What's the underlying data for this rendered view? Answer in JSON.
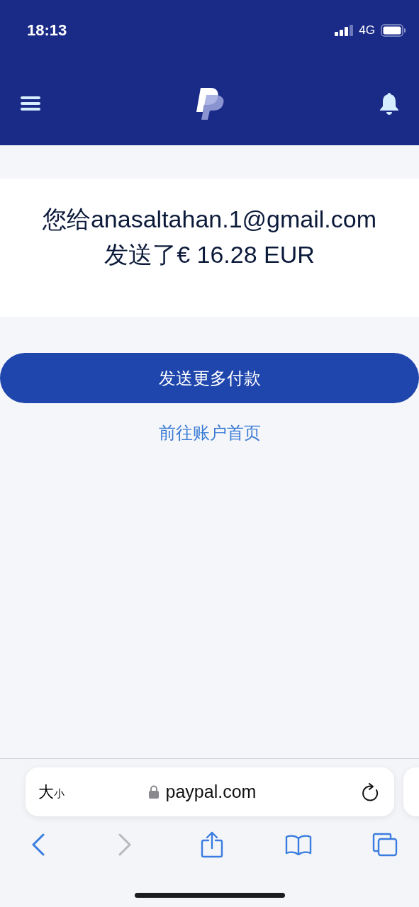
{
  "status_bar": {
    "time": "18:13",
    "network": "4G"
  },
  "message_lines": [
    "您给anasaltahan.1@gmail.com",
    "发送了€ 16.28 EUR"
  ],
  "actions": {
    "primary": "发送更多付款",
    "link": "前往账户首页"
  },
  "browser": {
    "text_size": {
      "big": "大",
      "small": "小"
    },
    "address": "paypal.com",
    "nav": [
      {
        "kind": "back",
        "disabled": false
      },
      {
        "kind": "forward",
        "disabled": true
      },
      {
        "kind": "share",
        "disabled": false
      },
      {
        "kind": "bookmarks",
        "disabled": false
      },
      {
        "kind": "tabs",
        "disabled": false
      }
    ]
  }
}
